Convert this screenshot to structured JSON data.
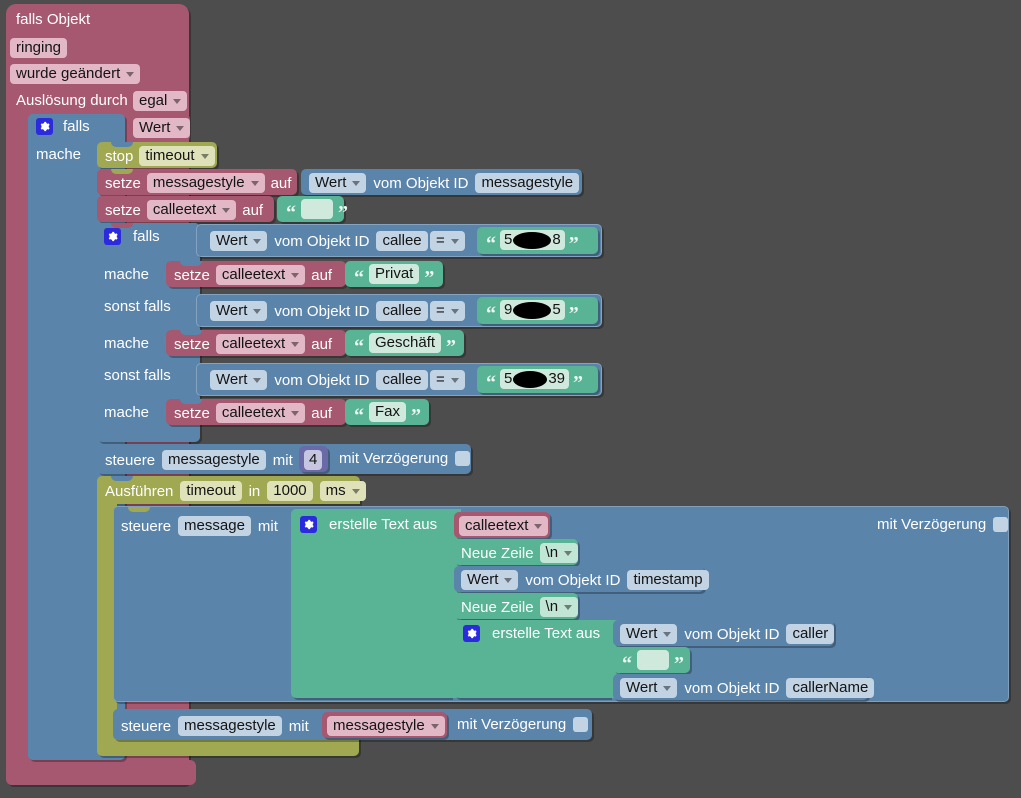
{
  "meta": {
    "background_color": "#4d4d4d",
    "colors": {
      "pink": "#a5586f",
      "blue": "#5b84ab",
      "olive": "#a0a851",
      "green": "#59b495",
      "purple": "#6a6aa8"
    }
  },
  "trigger": {
    "title": "falls Objekt",
    "object_id": "ringing",
    "condition": "wurde geändert",
    "source_label": "Auslösung durch",
    "source_value": "egal"
  },
  "if_outer": {
    "label": "falls",
    "do_label": "mache",
    "condition_value": "Wert"
  },
  "stop_block": {
    "label": "stop",
    "target": "timeout"
  },
  "set_messagestyle": {
    "setze": "setze",
    "variable": "messagestyle",
    "auf": "auf",
    "value_dropdown": "Wert",
    "value_label": "vom Objekt ID",
    "object_id": "messagestyle"
  },
  "set_calleetext_empty": {
    "setze": "setze",
    "variable": "calleetext",
    "auf": "auf",
    "text": ""
  },
  "if_inner": {
    "if_label": "falls",
    "elseif_label": "sonst falls",
    "do_label": "mache",
    "branches": [
      {
        "condition": {
          "dropdown": "Wert",
          "label": "vom Objekt ID",
          "object_id": "callee",
          "operator": "=",
          "compare_prefix": "5",
          "compare_suffix": "8",
          "redacted": true
        },
        "action": {
          "setze": "setze",
          "variable": "calleetext",
          "auf": "auf",
          "text": "Privat"
        }
      },
      {
        "condition": {
          "dropdown": "Wert",
          "label": "vom Objekt ID",
          "object_id": "callee",
          "operator": "=",
          "compare_prefix": "9",
          "compare_suffix": "5",
          "redacted": true
        },
        "action": {
          "setze": "setze",
          "variable": "calleetext",
          "auf": "auf",
          "text": "Geschäft"
        }
      },
      {
        "condition": {
          "dropdown": "Wert",
          "label": "vom Objekt ID",
          "object_id": "callee",
          "operator": "=",
          "compare_prefix": "5",
          "compare_suffix": "39",
          "redacted": true
        },
        "action": {
          "setze": "setze",
          "variable": "calleetext",
          "auf": "auf",
          "text": "Fax"
        }
      }
    ]
  },
  "control_messagestyle_4": {
    "steuere": "steuere",
    "target": "messagestyle",
    "mit": "mit",
    "number": "4",
    "delay_label": "mit Verzögerung",
    "delay_checked": false
  },
  "timeout_block": {
    "ausfuehren": "Ausführen",
    "name": "timeout",
    "in": "in",
    "duration": "1000",
    "unit": "ms"
  },
  "control_message": {
    "steuere": "steuere",
    "target": "message",
    "mit": "mit",
    "delay_label": "mit Verzögerung",
    "delay_checked": false,
    "create_text": {
      "label": "erstelle Text aus",
      "items": [
        {
          "type": "variable",
          "name": "calleetext"
        },
        {
          "type": "newline",
          "label": "Neue Zeile",
          "value": "\\n"
        },
        {
          "type": "objvalue",
          "dropdown": "Wert",
          "label": "vom Objekt ID",
          "object_id": "timestamp"
        },
        {
          "type": "newline",
          "label": "Neue Zeile",
          "value": "\\n"
        },
        {
          "type": "nested_create_text",
          "label": "erstelle Text aus",
          "items": [
            {
              "type": "objvalue",
              "dropdown": "Wert",
              "label": "vom Objekt ID",
              "object_id": "caller"
            },
            {
              "type": "text",
              "value": ""
            },
            {
              "type": "objvalue",
              "dropdown": "Wert",
              "label": "vom Objekt ID",
              "object_id": "callerName"
            }
          ]
        }
      ]
    }
  },
  "control_messagestyle_var": {
    "steuere": "steuere",
    "target": "messagestyle",
    "mit": "mit",
    "variable": "messagestyle",
    "delay_label": "mit Verzögerung",
    "delay_checked": false
  }
}
